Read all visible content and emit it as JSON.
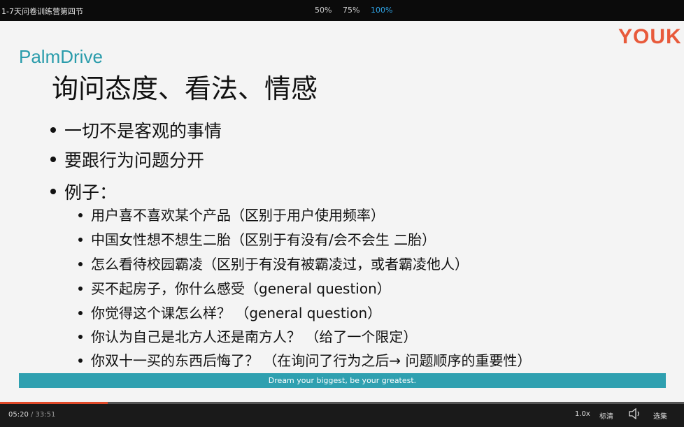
{
  "video": {
    "title": "1-7天问卷训练营第四节",
    "zoom_options": [
      {
        "label": "50%",
        "active": false
      },
      {
        "label": "75%",
        "active": false
      },
      {
        "label": "100%",
        "active": true
      }
    ]
  },
  "slide": {
    "brand": "PalmDrive",
    "watermark": "YOUK",
    "heading": "询问态度、看法、情感",
    "bullets": [
      "一切不是客观的事情",
      "要跟行为问题分开",
      "例子："
    ],
    "examples": [
      "用户喜不喜欢某个产品（区别于用户使用频率）",
      "中国女性想不想生二胎（区别于有没有/会不会生 二胎）",
      "怎么看待校园霸凌（区别于有没有被霸凌过，或者霸凌他人）",
      "买不起房子，你什么感受（general question）",
      "你觉得这个课怎么样？ （general question）",
      "你认为自己是北方人还是南方人？ （给了一个限定）",
      "你双十一买的东西后悔了？ （在询问了行为之后→ 问题顺序的重要性）"
    ],
    "footer": "Dream your biggest, be your greatest."
  },
  "player": {
    "current_time": "05:20",
    "total_time": " / 33:51",
    "progress_fraction": 0.157,
    "speed": "1.0x",
    "quality": "标清",
    "episodes": "选集"
  },
  "colors": {
    "accent_teal": "#2fa0b0",
    "youku_red": "#e85a3b",
    "active_blue": "#2fa4e7",
    "progress_red": "#e04a2a"
  }
}
